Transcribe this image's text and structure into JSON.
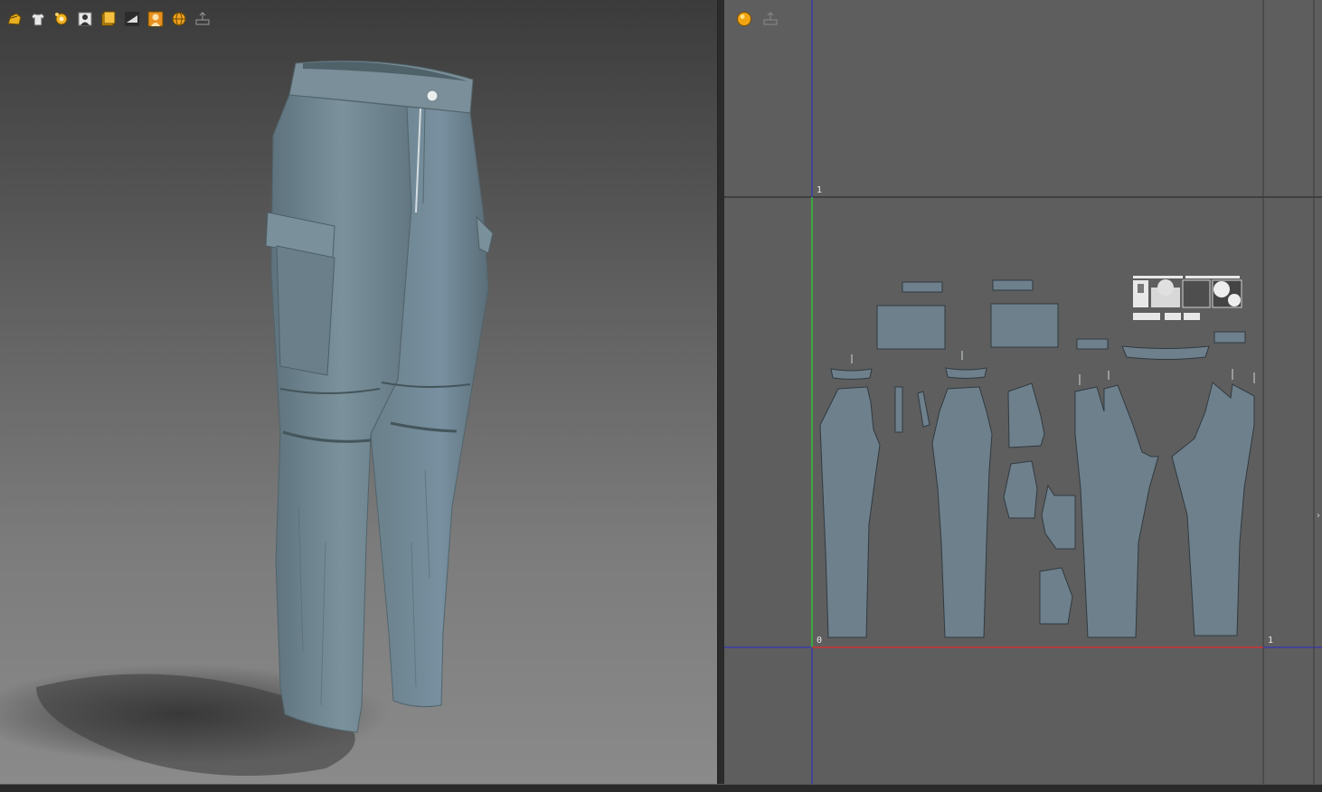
{
  "viewport3d": {
    "toolbar": [
      {
        "icon": "avatar-hair-icon"
      },
      {
        "icon": "garment-shirt-icon"
      },
      {
        "icon": "fabric-texture-icon"
      },
      {
        "icon": "avatar-body-icon"
      },
      {
        "icon": "layer-pages-icon"
      },
      {
        "icon": "surface-flatten-icon"
      },
      {
        "icon": "avatar-silhouette-icon"
      },
      {
        "icon": "globe-icon"
      },
      {
        "icon": "export-icon"
      }
    ],
    "garment_color": "#6f858f",
    "background_top": "#3b3b3b",
    "background_bottom": "#8a8a8a"
  },
  "viewport2d": {
    "toolbar": [
      {
        "icon": "material-sphere-icon"
      },
      {
        "icon": "export-grid-icon"
      }
    ],
    "uv_labels": {
      "origin": "0",
      "u_max": "1",
      "v_max": "1"
    },
    "axis_colors": {
      "u_axis": "#d03030",
      "v_axis": "#30c030",
      "grid": "#2020c0"
    },
    "piece_color": "#6e808c",
    "background": "#5e5e5e"
  }
}
